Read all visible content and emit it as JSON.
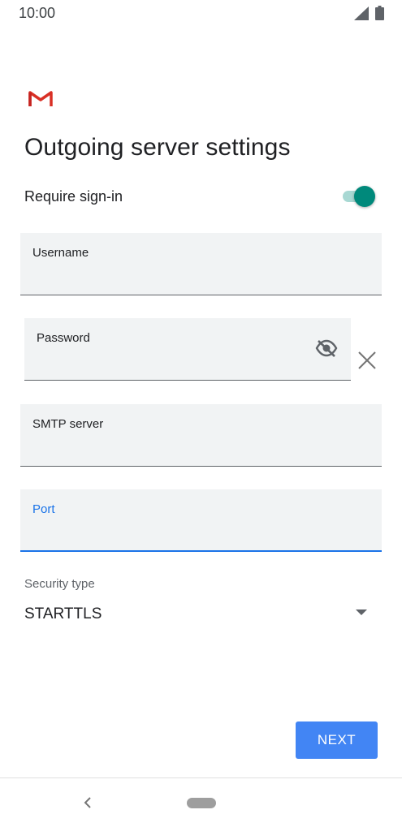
{
  "status_bar": {
    "time": "10:00",
    "icons": [
      "signal-icon",
      "battery-icon"
    ]
  },
  "header": {
    "logo": "gmail-logo",
    "title": "Outgoing server settings"
  },
  "require_signin": {
    "label": "Require sign-in",
    "enabled": true,
    "accent_color": "#00897b"
  },
  "fields": {
    "username": {
      "label": "Username",
      "value": ""
    },
    "password": {
      "label": "Password",
      "value": "",
      "visibility_icon": "eye-off-icon",
      "clear_icon": "close-icon"
    },
    "smtp_server": {
      "label": "SMTP server",
      "value": ""
    },
    "port": {
      "label": "Port",
      "value": "",
      "focused": true,
      "focus_color": "#1a73e8"
    }
  },
  "security": {
    "label": "Security type",
    "value": "STARTTLS",
    "icon": "dropdown-arrow-icon"
  },
  "actions": {
    "next_label": "NEXT",
    "next_color": "#4285f4"
  },
  "nav_bar": {
    "back_icon": "back-icon",
    "home_icon": "home-pill"
  }
}
